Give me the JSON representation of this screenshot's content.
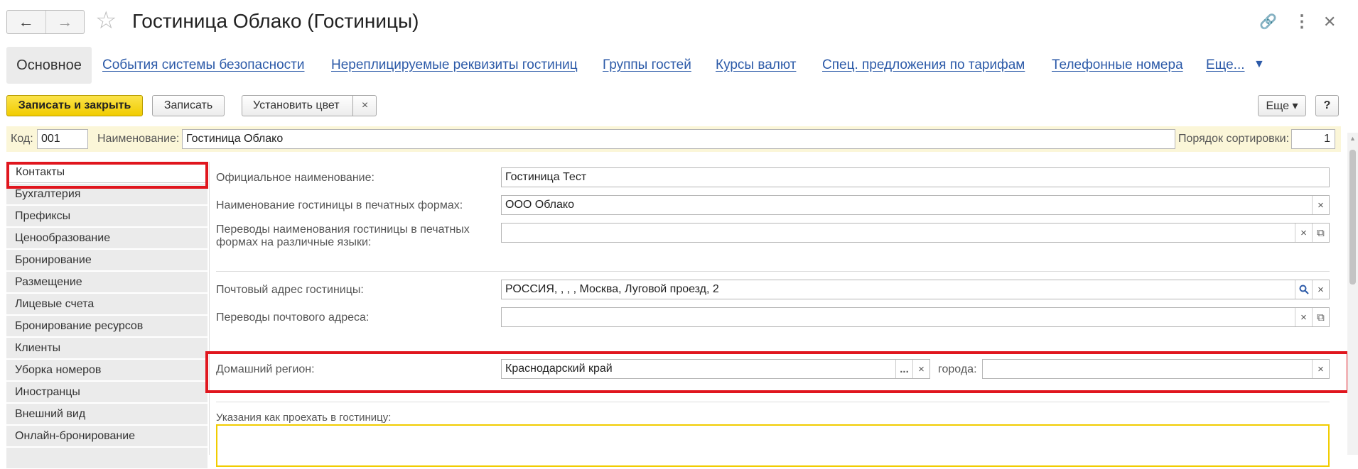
{
  "window": {
    "title": "Гостиница Облако (Гостиницы)",
    "back_icon": "←",
    "forward_icon": "→",
    "star_icon": "☆",
    "link_icon": "🔗",
    "more_icon": "⋮",
    "close_icon": "✕"
  },
  "tabs": {
    "main": "Основное",
    "links": [
      "События системы безопасности",
      "Нереплицируемые реквизиты гостиниц",
      "Группы гостей",
      "Курсы валют",
      "Спец. предложения по тарифам",
      "Телефонные номера",
      "Еще..."
    ],
    "more_arrow": "▼"
  },
  "toolbar": {
    "save_close": "Записать и закрыть",
    "save": "Записать",
    "set_color": "Установить цвет",
    "clear": "×",
    "more": "Еще ▾",
    "help": "?"
  },
  "header": {
    "code_label": "Код:",
    "code_value": "001",
    "name_label": "Наименование:",
    "name_value": "Гостиница Облако",
    "sort_label": "Порядок сортировки:",
    "sort_value": "1"
  },
  "sidebar": {
    "items": [
      "Контакты",
      "Бухгалтерия",
      "Префиксы",
      "Ценообразование",
      "Бронирование",
      "Размещение",
      "Лицевые счета",
      "Бронирование ресурсов",
      "Клиенты",
      "Уборка номеров",
      "Иностранцы",
      "Внешний вид",
      "Онлайн-бронирование"
    ],
    "selected": "Контакты"
  },
  "form": {
    "official_name_label": "Официальное наименование:",
    "official_name_value": "Гостиница Тест",
    "print_name_label": "Наименование гостиницы в печатных формах:",
    "print_name_value": "ООО Облако",
    "translations_label_line1": "Переводы наименования гостиницы в печатных",
    "translations_label_line2": "формах на различные языки:",
    "translations_value": "",
    "postal_label": "Почтовый адрес гостиницы:",
    "postal_value": "РОССИЯ, , , , Москва, Луговой проезд, 2",
    "postal_translations_label": "Переводы почтового адреса:",
    "postal_translations_value": "",
    "region_label": "Домашний регион:",
    "region_value": "Краснодарский край",
    "city_label": "города:",
    "city_value": "",
    "directions_label": "Указания как проехать в гостиницу:",
    "directions_value": "",
    "clear_icon": "×",
    "open_icon": "⧉",
    "search_icon": "🔍",
    "select_icon": "..."
  },
  "colors": {
    "accent_yellow": "#f1cc00",
    "link_blue": "#2c5aa8",
    "highlight_red": "#e0161e",
    "header_bg": "#fbf6d8"
  }
}
